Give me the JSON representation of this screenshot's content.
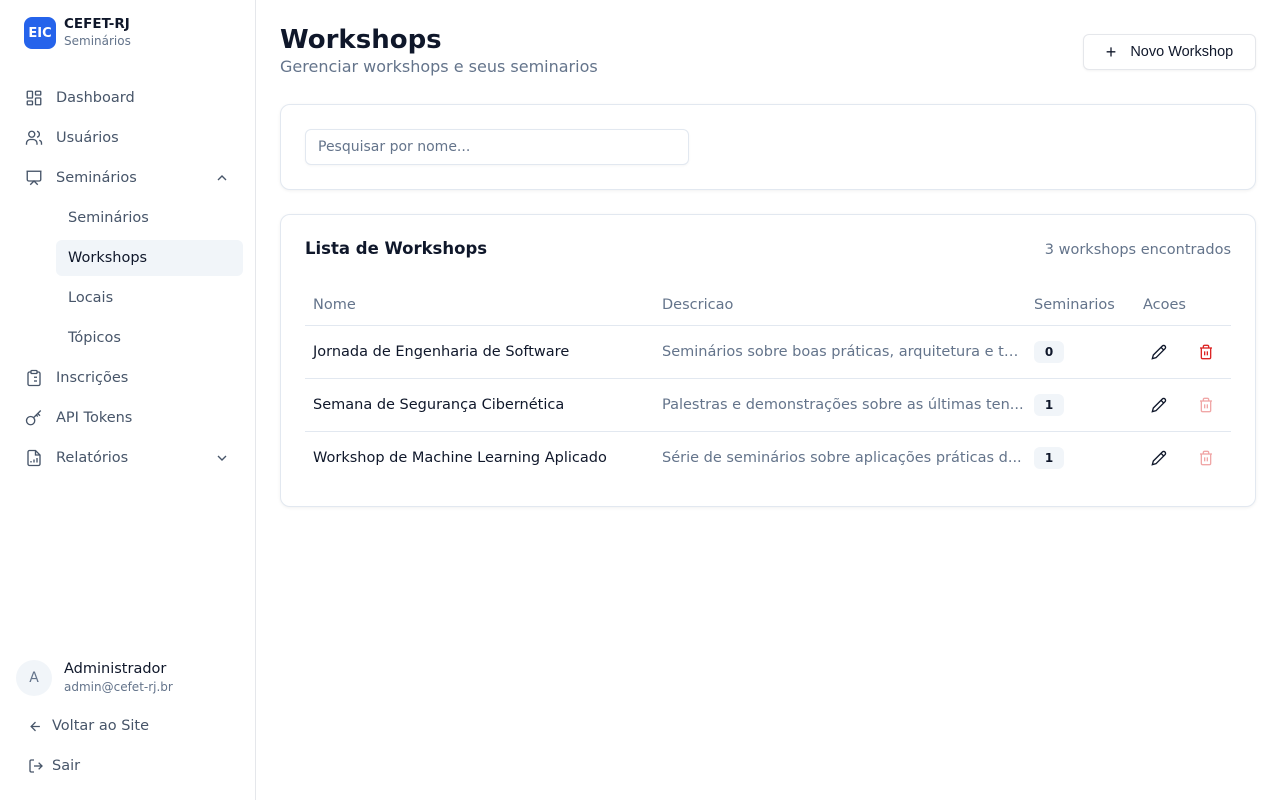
{
  "brand": {
    "logo": "EIC",
    "title": "CEFET-RJ",
    "subtitle": "Seminários"
  },
  "nav": {
    "dashboard": "Dashboard",
    "usuarios": "Usuários",
    "seminarios": "Seminários",
    "sub": {
      "seminarios": "Seminários",
      "workshops": "Workshops",
      "locais": "Locais",
      "topicos": "Tópicos"
    },
    "inscricoes": "Inscrições",
    "api_tokens": "API Tokens",
    "relatorios": "Relatórios"
  },
  "user": {
    "initial": "A",
    "name": "Administrador",
    "email": "admin@cefet-rj.br"
  },
  "footer": {
    "back": "Voltar ao Site",
    "logout": "Sair"
  },
  "page": {
    "title": "Workshops",
    "subtitle": "Gerenciar workshops e seus seminarios",
    "new_button": "Novo Workshop"
  },
  "search": {
    "placeholder": "Pesquisar por nome..."
  },
  "list": {
    "title": "Lista de Workshops",
    "count": "3 workshops encontrados",
    "headers": {
      "name": "Nome",
      "description": "Descricao",
      "seminars": "Seminarios",
      "actions": "Acoes"
    },
    "rows": [
      {
        "name": "Jornada de Engenharia de Software",
        "description": "Seminários sobre boas práticas, arquitetura e te...",
        "seminars": "0",
        "delete_enabled": true
      },
      {
        "name": "Semana de Segurança Cibernética",
        "description": "Palestras e demonstrações sobre as últimas ten...",
        "seminars": "1",
        "delete_enabled": false
      },
      {
        "name": "Workshop de Machine Learning Aplicado",
        "description": "Série de seminários sobre aplicações práticas d...",
        "seminars": "1",
        "delete_enabled": false
      }
    ]
  },
  "colors": {
    "brand": "#2563eb",
    "danger": "#dc2626",
    "muted": "#64748b",
    "active_bg": "#f1f5f9"
  }
}
